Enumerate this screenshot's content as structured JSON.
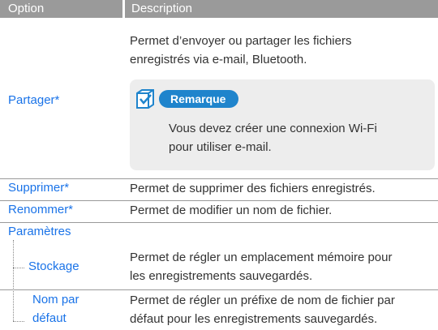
{
  "header": {
    "option": "Option",
    "description": "Description"
  },
  "rows": {
    "share": {
      "option": "Partager*",
      "desc_line1": "Permet d’envoyer ou partager les fichiers",
      "desc_line2": "enregistrés via e-mail, Bluetooth.",
      "note": {
        "title": "Remarque",
        "line1": "Vous devez créer une connexion Wi-Fi",
        "line2": "pour utiliser e-mail."
      }
    },
    "delete": {
      "option": "Supprimer*",
      "desc": "Permet de supprimer des fichiers enregistrés."
    },
    "rename": {
      "option": "Renommer*",
      "desc": "Permet de modifier un nom de fichier."
    },
    "settings": {
      "option": "Paramètres",
      "storage": {
        "option": "Stockage",
        "desc_line1": "Permet de régler un emplacement mémoire pour",
        "desc_line2": "les enregistrements sauvegardés."
      },
      "default_name": {
        "option_line1": "Nom par",
        "option_line2": "défaut",
        "desc_line1": "Permet de régler un préfixe de nom de fichier par",
        "desc_line2": "défaut pour les enregistrements sauvegardés."
      }
    }
  },
  "icons": {
    "note": "note-checkbox-icon"
  },
  "colors": {
    "accent": "#1f84cc",
    "option_text": "#1a73e8",
    "header_bg": "#9a9a9a",
    "note_bg": "#ededed"
  }
}
